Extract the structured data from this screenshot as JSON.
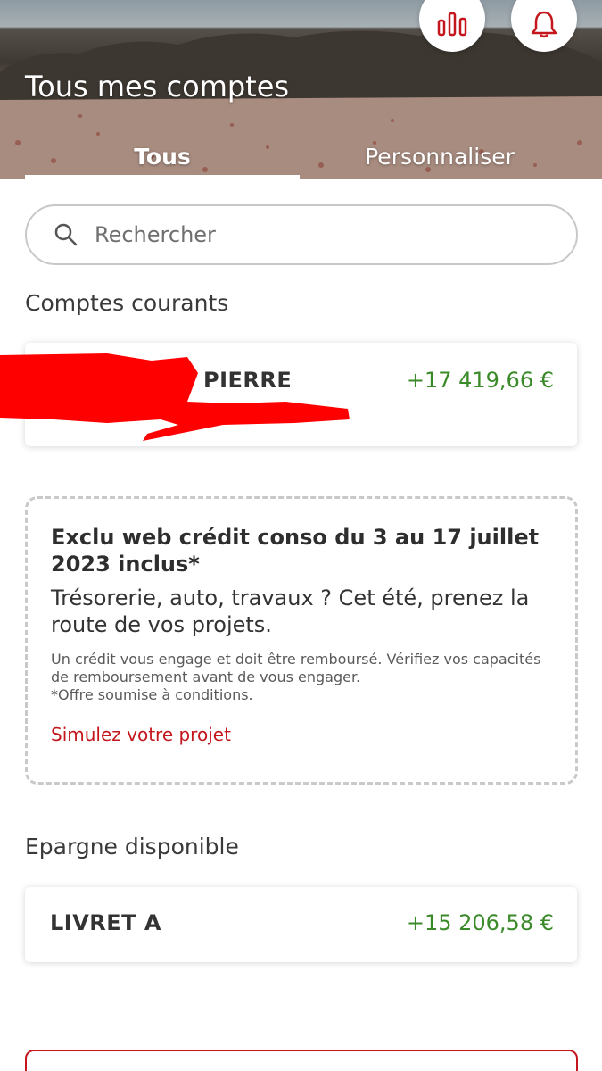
{
  "header": {
    "title": "Tous mes comptes",
    "stats_icon": "bar-chart-icon",
    "notifications_icon": "bell-icon"
  },
  "tabs": [
    {
      "label": "Tous",
      "active": true
    },
    {
      "label": "Personnaliser",
      "active": false
    }
  ],
  "search": {
    "placeholder": "Rechercher",
    "icon": "search-icon"
  },
  "sections": {
    "current": {
      "title": "Comptes courants",
      "accounts": [
        {
          "name": "PIERRE",
          "amount": "+17 419,66 €"
        }
      ]
    },
    "savings": {
      "title": "Epargne disponible",
      "accounts": [
        {
          "name": "LIVRET A",
          "amount": "+15 206,58 €"
        }
      ]
    }
  },
  "promo": {
    "title": "Exclu web crédit conso du 3 au 17 juillet 2023 inclus*",
    "subtitle": "Trésorerie, auto, travaux ? Cet été, prenez la route de vos projets.",
    "legal": "Un crédit vous engage et doit être remboursé. Vérifiez vos capacités de remboursement avant de vous engager.",
    "legal_note": "*Offre soumise à conditions.",
    "link": "Simulez votre projet"
  },
  "colors": {
    "accent_red": "#c4161c",
    "amount_green": "#3b8a2a",
    "redaction": "#ff0000"
  }
}
